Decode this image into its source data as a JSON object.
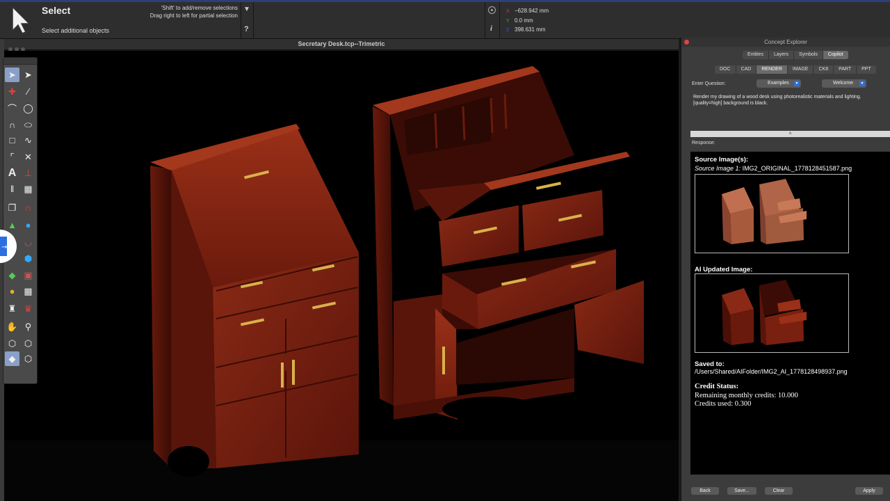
{
  "toolbar": {
    "tool_name": "Select",
    "tool_subtitle": "Select additional objects",
    "hint_line1": "'Shift' to add/remove selections",
    "hint_line2": "Drag right to left for partial selection",
    "help_label": "?",
    "info_label": "i",
    "coords": [
      {
        "axis": "X",
        "value": "−628.942 mm",
        "color": "#d04040"
      },
      {
        "axis": "Y",
        "value": "0.0 mm",
        "color": "#40b040"
      },
      {
        "axis": "Z",
        "value": "398.631 mm",
        "color": "#4060d0"
      }
    ]
  },
  "window": {
    "title": "Secretary Desk.tcp--Trimetric"
  },
  "panel": {
    "title": "Concept Explorer",
    "tabs": [
      "Entities",
      "Layers",
      "Symbols",
      "Copilot"
    ],
    "active_tab": "Copilot",
    "subtabs": [
      "DOC",
      "CAD",
      "RENDER",
      "IMAGE",
      "CK8",
      "PART",
      "PPT"
    ],
    "active_subtab": "RENDER",
    "enter_question_label": "Enter Question:",
    "examples_dropdown": "Examples",
    "welcome_dropdown": "Welcome",
    "question_text": "Render my drawing of a wood desk using photorealistic materials and lighting. [quality=high] background is black.",
    "collapse_glyph": "˄",
    "response_label": "Response:",
    "response": {
      "source_heading": "Source Image(s):",
      "source_caption_label": "Source Image 1:",
      "source_caption_file": "IMG2_ORIGINAL_1778128451587.png",
      "ai_heading": "AI Updated Image:",
      "saved_heading": "Saved to:",
      "saved_path": "/Users/Shared/AIFolder/IMG2_AI_1778128498937.png",
      "credit_heading": "Credit Status:",
      "remaining_credits": "Remaining monthly credits: 10.000",
      "credits_used": "Credits used: 0.300"
    },
    "buttons": {
      "back": "Back",
      "save": "Save...",
      "clear": "Clear",
      "apply": "Apply"
    }
  },
  "colors": {
    "wood": "#7a1f10",
    "wood_dark": "#4a1008",
    "handle": "#d8b24a",
    "accent": "#2d6fe0"
  }
}
